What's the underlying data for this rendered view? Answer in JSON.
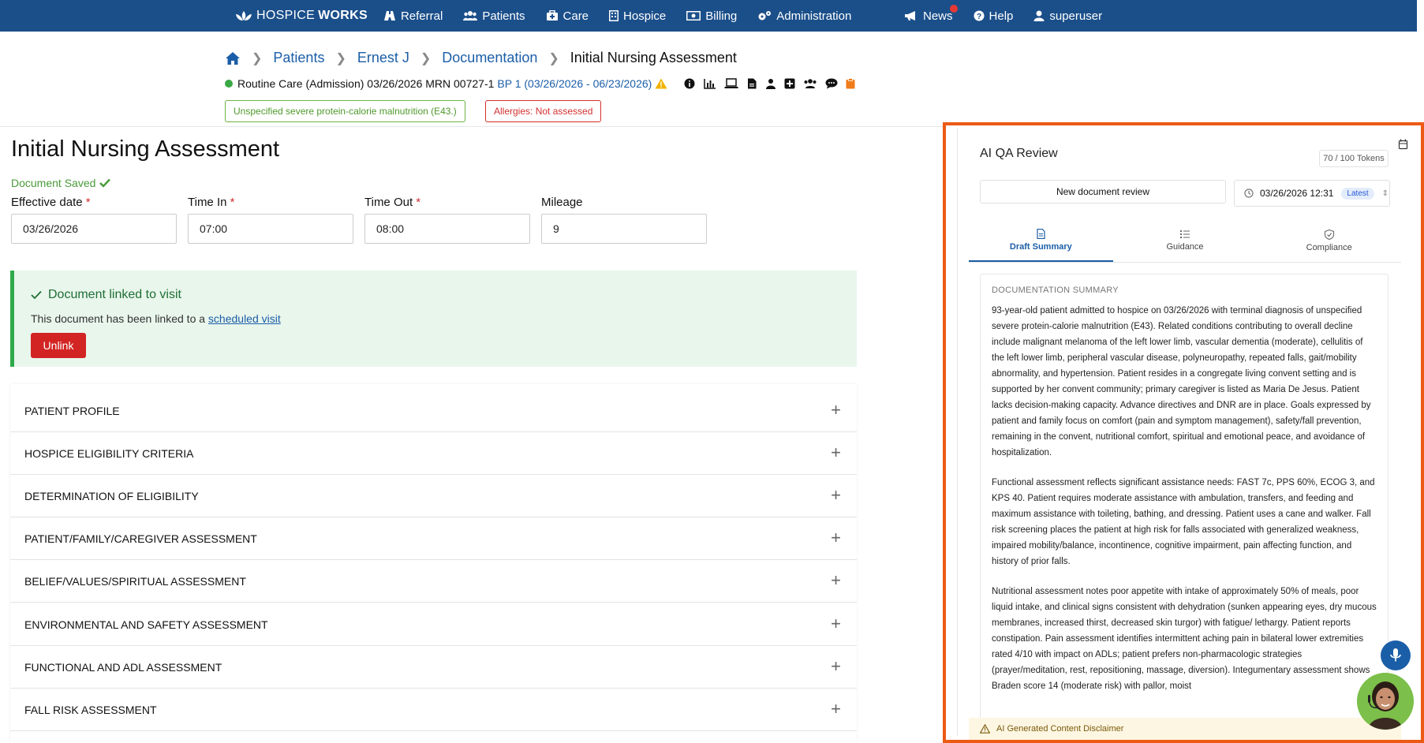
{
  "nav": {
    "brand_a": "HOSPICE",
    "brand_b": "WORKS",
    "items": [
      "Referral",
      "Patients",
      "Care",
      "Hospice",
      "Billing",
      "Administration"
    ],
    "news": "News",
    "help": "Help",
    "user": "superuser"
  },
  "breadcrumb": {
    "home_icon": "home-icon",
    "items": [
      "Patients",
      "Ernest J",
      "Documentation"
    ],
    "current": "Initial Nursing Assessment"
  },
  "patient_bar": {
    "care": "Routine Care",
    "admission": "(Admission) 03/26/2026 MRN 00727-1",
    "bp": "BP 1 (03/26/2026 - 06/23/2026)",
    "status_color": "#3aa845"
  },
  "tags": {
    "diagnosis": "Unspecified severe protein-calorie malnutrition (E43.)",
    "allergies": "Allergies: Not assessed"
  },
  "page": {
    "title": "Initial Nursing Assessment",
    "saved": "Document Saved"
  },
  "fields": {
    "effective_date_label": "Effective date",
    "effective_date": "03/26/2026",
    "time_in_label": "Time In",
    "time_in": "07:00",
    "time_out_label": "Time Out",
    "time_out": "08:00",
    "mileage_label": "Mileage",
    "mileage": "9",
    "required_mark": "*"
  },
  "linked": {
    "title": "Document linked to visit",
    "desc": "This document has been linked to a",
    "link": "scheduled visit",
    "unlink": "Unlink"
  },
  "sections": [
    "PATIENT PROFILE",
    "HOSPICE ELIGIBILITY CRITERIA",
    "DETERMINATION OF ELIGIBILITY",
    "PATIENT/FAMILY/CAREGIVER ASSESSMENT",
    "BELIEF/VALUES/SPIRITUAL ASSESSMENT",
    "ENVIRONMENTAL AND SAFETY ASSESSMENT",
    "FUNCTIONAL AND ADL ASSESSMENT",
    "FALL RISK ASSESSMENT"
  ],
  "qa": {
    "title": "AI QA Review",
    "tokens": "70 / 100 Tokens",
    "new_review": "New document review",
    "date": "03/26/2026 12:31",
    "latest": "Latest",
    "tabs": [
      "Draft Summary",
      "Guidance",
      "Compliance"
    ],
    "summary_header": "DOCUMENTATION SUMMARY",
    "paragraphs": [
      "93-year-old patient admitted to hospice on 03/26/2026 with terminal diagnosis of unspecified severe protein-calorie malnutrition (E43). Related conditions contributing to overall decline include malignant melanoma of the left lower limb, vascular dementia (moderate), cellulitis of the left lower limb, peripheral vascular disease, polyneuropathy, repeated falls, gait/mobility abnormality, and hypertension. Patient resides in a congregate living convent setting and is supported by her convent community; primary caregiver is listed as Maria De Jesus. Patient lacks decision-making capacity. Advance directives and DNR are in place. Goals expressed by patient and family focus on comfort (pain and symptom management), safety/fall prevention, remaining in the convent, nutritional comfort, spiritual and emotional peace, and avoidance of hospitalization.",
      "Functional assessment reflects significant assistance needs: FAST 7c, PPS 60%, ECOG 3, and KPS 40. Patient requires moderate assistance with ambulation, transfers, and feeding and maximum assistance with toileting, bathing, and dressing. Patient uses a cane and walker. Fall risk screening places the patient at high risk for falls associated with generalized weakness, impaired mobility/balance, incontinence, cognitive impairment, pain affecting function, and history of prior falls.",
      "Nutritional assessment notes poor appetite with intake of approximately 50% of meals, poor liquid intake, and clinical signs consistent with dehydration (sunken appearing eyes, dry mucous membranes, increased thirst, decreased skin turgor) with fatigue/ lethargy. Patient reports constipation. Pain assessment identifies intermittent aching pain in bilateral lower extremities rated 4/10 with impact on ADLs; patient prefers non-pharmacologic strategies (prayer/meditation, rest, repositioning, massage, diversion). Integumentary assessment shows Braden score 14 (moderate risk) with pallor, moist"
    ],
    "disclaimer": "AI Generated Content Disclaimer"
  }
}
